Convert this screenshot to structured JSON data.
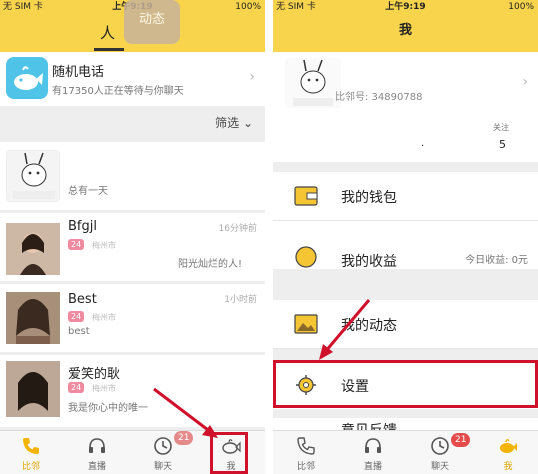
{
  "status_bar": {
    "carrier": "无 SIM 卡",
    "time": "上午9:19",
    "battery": "100%"
  },
  "left": {
    "tabs": {
      "people": "人",
      "dynamics": "动态"
    },
    "random_call": {
      "title": "随机电话",
      "subtitle": "有17350人正在等待与你聊天"
    },
    "filter": "筛选",
    "list": [
      {
        "name": "",
        "message": "总有一天",
        "time": "",
        "badge": "",
        "city": ""
      },
      {
        "name": "Bfgjl",
        "badge": "24",
        "city": "梅州市",
        "message": "阳光灿烂的人!",
        "time": "16分钟前"
      },
      {
        "name": "Best",
        "badge": "24",
        "city": "梅州市",
        "message": "best",
        "time": "1小时前"
      },
      {
        "name": "爱笑的耿",
        "badge": "24",
        "city": "梅州市",
        "message": "我是你心中的唯一",
        "time": ""
      }
    ],
    "tabbar": {
      "nearby": "比邻",
      "live": "直播",
      "chat": "聊天",
      "chat_badge": "21",
      "me": "我"
    }
  },
  "right": {
    "title": "我",
    "profile": {
      "id_label": "比邻号: 34890788",
      "follow_label": "关注",
      "follow_count": "5",
      "dot": "."
    },
    "menu": {
      "wallet": "我的钱包",
      "income_label": "我的收益",
      "income_today": "今日收益: 0元",
      "dynamics": "我的动态",
      "settings": "设置",
      "feedback": "意见反馈"
    },
    "tabbar": {
      "nearby": "比邻",
      "live": "直播",
      "chat": "聊天",
      "chat_badge": "21",
      "me": "我"
    }
  },
  "colors": {
    "brand_yellow": "#f7d44c",
    "highlight_red": "#d0112b",
    "badge_pink": "#f08aa0"
  }
}
